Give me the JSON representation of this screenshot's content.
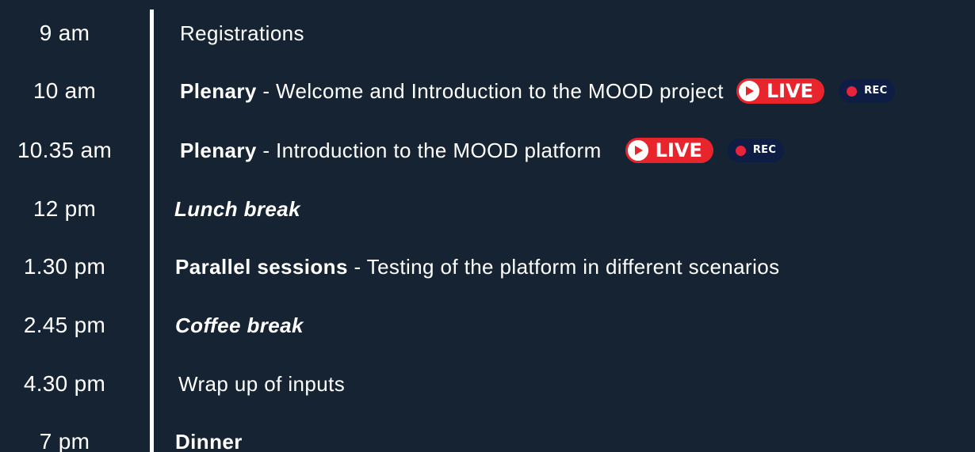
{
  "agenda": [
    {
      "time": "9 am",
      "bold": "",
      "text": "Registrations"
    },
    {
      "time": "10 am",
      "bold": "Plenary",
      "text": " - Welcome and Introduction to the MOOD project",
      "live": "LIVE",
      "rec": "REC"
    },
    {
      "time": "10.35 am",
      "bold": "Plenary",
      "text": " - Introduction to the MOOD platform",
      "live": "LIVE",
      "rec": "REC"
    },
    {
      "time": "12 pm",
      "italic": "Lunch break"
    },
    {
      "time": "1.30 pm",
      "bold": "Parallel sessions",
      "text": " - Testing of the platform in different scenarios"
    },
    {
      "time": "2.45 pm",
      "italic": "Coffee break"
    },
    {
      "time": "4.30 pm",
      "bold": "",
      "text": "Wrap up of inputs"
    },
    {
      "time": "7 pm",
      "bold": "Dinner",
      "text": ""
    }
  ],
  "colors": {
    "background": "#162332",
    "live_badge": "#e8242c",
    "rec_badge": "#0e1d44",
    "text": "#ffffff"
  },
  "icons": {
    "live": "play-icon",
    "rec": "record-dot-icon"
  }
}
